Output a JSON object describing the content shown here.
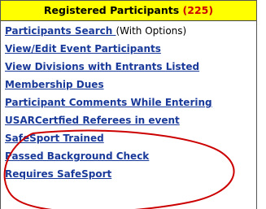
{
  "panel": {
    "title": "Registered Participants",
    "count_open": "(",
    "count": "225",
    "count_close": ")"
  },
  "menu": {
    "items": [
      {
        "label": "Participants Search ",
        "note": "(With Options)"
      },
      {
        "label": "View/Edit Event Participants"
      },
      {
        "label": "View Divisions with Entrants Listed"
      },
      {
        "label": "Membership Dues"
      },
      {
        "label": "Participant Comments While Entering"
      },
      {
        "label": "USARCertfied Referees in event"
      },
      {
        "label": "SafeSport Trained"
      },
      {
        "label": "Passed Background Check"
      },
      {
        "label": "Requires SafeSport"
      }
    ]
  },
  "colors": {
    "header_bg": "#ffff00",
    "count_text": "#cc0000",
    "link": "#1a3a9a",
    "annotation_stroke": "#cc0000"
  }
}
